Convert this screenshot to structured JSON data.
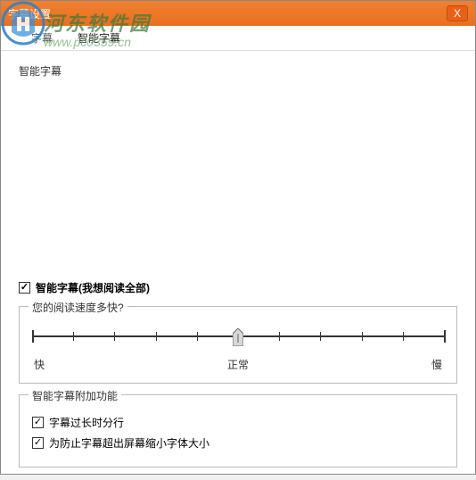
{
  "window": {
    "title": "字幕设置",
    "close_label": "X"
  },
  "tabs": {
    "items": [
      {
        "label": "字幕"
      },
      {
        "label": "智能字幕"
      }
    ]
  },
  "subtitle_heading": "智能字幕",
  "smart_subtitle": {
    "checkbox_label": "智能字幕(我想阅读全部)"
  },
  "speed": {
    "group_title": "您的阅读速度多快?",
    "label_fast": "快",
    "label_normal": "正常",
    "label_slow": "慢"
  },
  "addon": {
    "group_title": "智能字幕附加功能",
    "opt1_label": "字幕过长时分行",
    "opt2_label": "为防止字幕超出屏幕缩小字体大小"
  },
  "watermark": {
    "site_name": "河东软件园",
    "site_url": "www.pc0359.cn"
  }
}
